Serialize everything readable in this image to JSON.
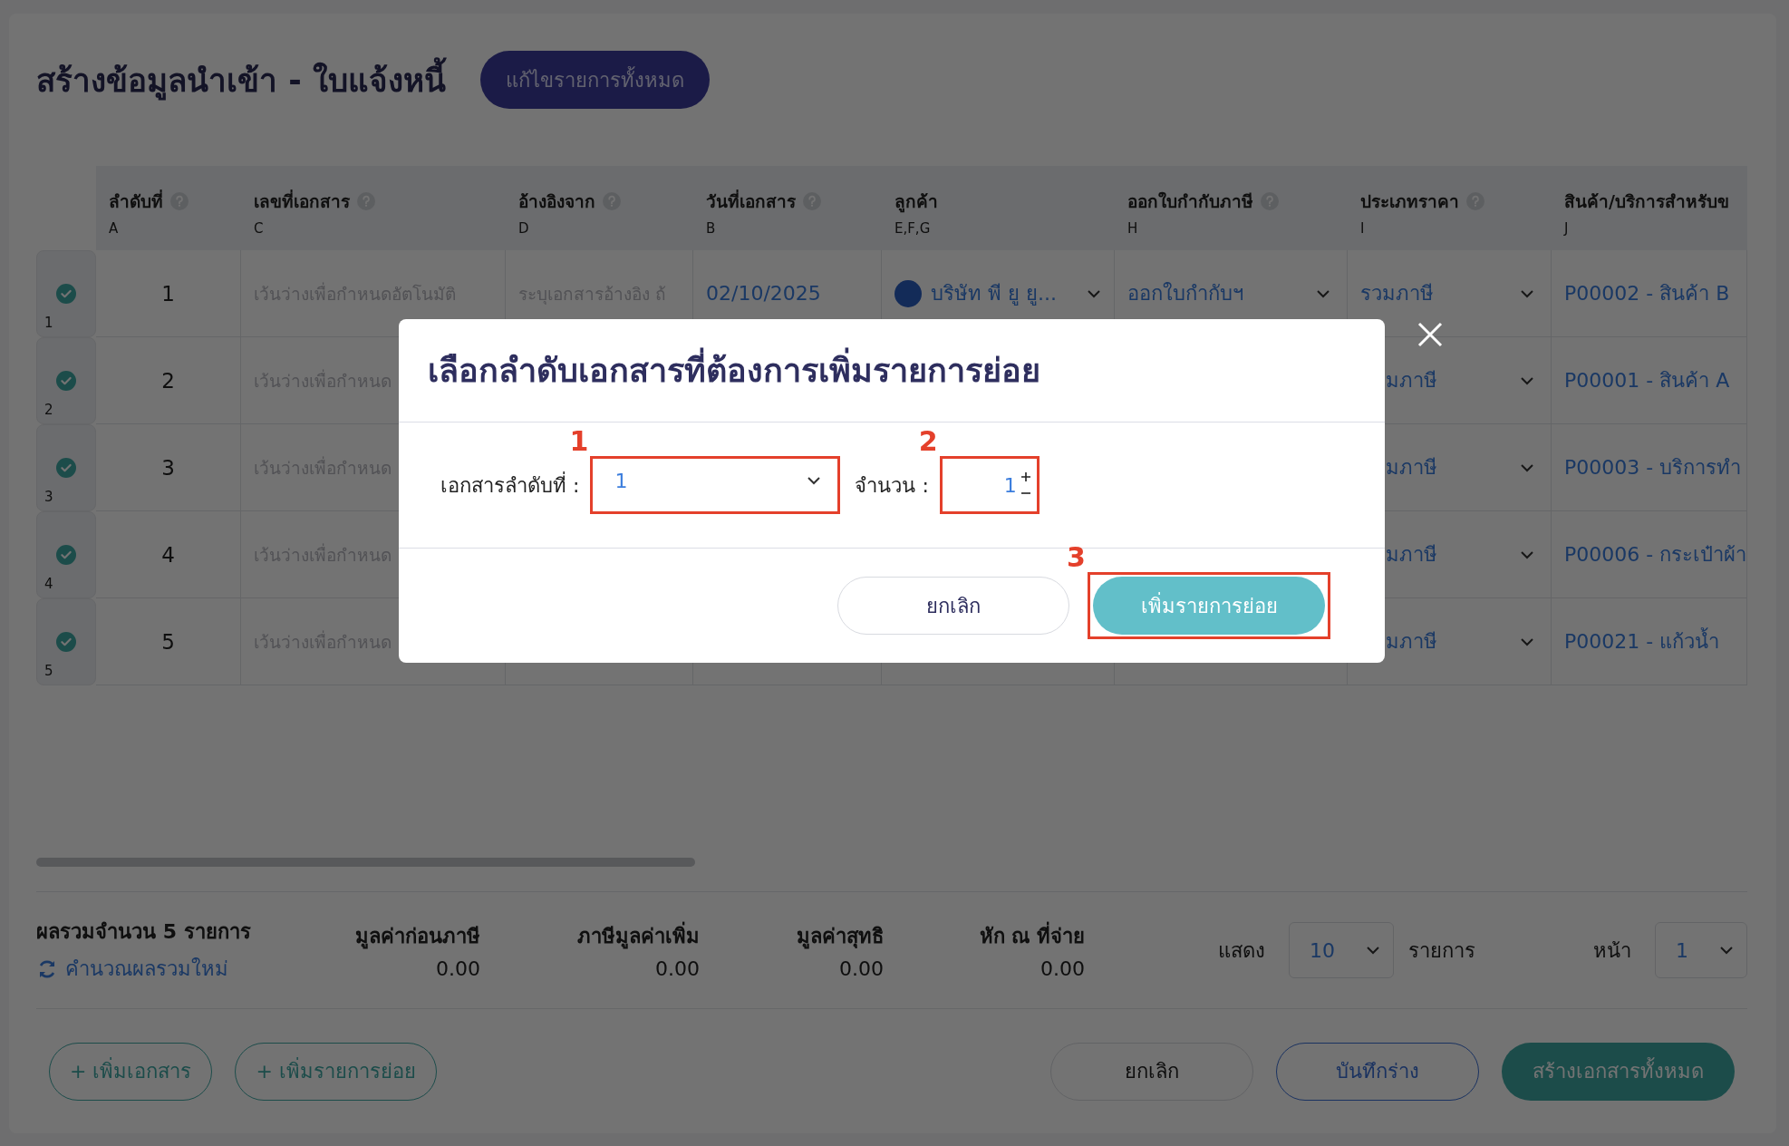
{
  "page": {
    "title": "สร้างข้อมูลนำเข้า - ใบแจ้งหนี้",
    "edit_all_button": "แก้ไขรายการทั้งหมด"
  },
  "table": {
    "columns": [
      {
        "label": "ลำดับที่",
        "letter": "A",
        "help": true
      },
      {
        "label": "เลขที่เอกสาร",
        "letter": "C",
        "help": true
      },
      {
        "label": "อ้างอิงจาก",
        "letter": "D",
        "help": true
      },
      {
        "label": "วันที่เอกสาร",
        "letter": "B",
        "help": true
      },
      {
        "label": "ลูกค้า",
        "letter": "E,F,G",
        "help": false
      },
      {
        "label": "ออกใบกำกับภาษี",
        "letter": "H",
        "help": true
      },
      {
        "label": "ประเภทราคา",
        "letter": "I",
        "help": true
      },
      {
        "label": "สินค้า/บริการสำหรับข",
        "letter": "J",
        "help": false
      }
    ],
    "rows": [
      {
        "row_label": "1",
        "checked": true,
        "cells": [
          {
            "kind": "number",
            "text": "1"
          },
          {
            "kind": "placeholder",
            "text": "เว้นว่างเพื่อกำหนดอัตโนมัติ"
          },
          {
            "kind": "placeholder",
            "text": "ระบุเอกสารอ้างอิง ถ้"
          },
          {
            "kind": "date",
            "text": "02/10/2025"
          },
          {
            "kind": "customer",
            "text": "บริษัท พี ยู ยู..."
          },
          {
            "kind": "select",
            "text": "ออกใบกำกับฯ"
          },
          {
            "kind": "select",
            "text": "รวมภาษี"
          },
          {
            "kind": "link",
            "text": "P00002 - สินค้า B"
          }
        ]
      },
      {
        "row_label": "2",
        "checked": true,
        "cells": [
          {
            "kind": "number",
            "text": "2"
          },
          {
            "kind": "placeholder",
            "text": "เว้นว่างเพื่อกำหนด"
          },
          {
            "kind": "hidden"
          },
          {
            "kind": "hidden"
          },
          {
            "kind": "hidden"
          },
          {
            "kind": "hidden"
          },
          {
            "kind": "select-covered",
            "text": "มภาษี"
          },
          {
            "kind": "link",
            "text": "P00001 - สินค้า A"
          }
        ]
      },
      {
        "row_label": "3",
        "checked": true,
        "cells": [
          {
            "kind": "number",
            "text": "3"
          },
          {
            "kind": "placeholder",
            "text": "เว้นว่างเพื่อกำหนด"
          },
          {
            "kind": "hidden"
          },
          {
            "kind": "hidden"
          },
          {
            "kind": "hidden"
          },
          {
            "kind": "hidden"
          },
          {
            "kind": "select-covered",
            "text": "มภาษี"
          },
          {
            "kind": "link",
            "text": "P00003 - บริการทำ"
          }
        ]
      },
      {
        "row_label": "4",
        "checked": true,
        "cells": [
          {
            "kind": "number",
            "text": "4"
          },
          {
            "kind": "placeholder",
            "text": "เว้นว่างเพื่อกำหนด"
          },
          {
            "kind": "hidden"
          },
          {
            "kind": "hidden"
          },
          {
            "kind": "hidden"
          },
          {
            "kind": "hidden"
          },
          {
            "kind": "select-covered",
            "text": "มภาษี"
          },
          {
            "kind": "link",
            "text": "P00006 - กระเป๋าผ้า"
          }
        ]
      },
      {
        "row_label": "5",
        "checked": true,
        "cells": [
          {
            "kind": "number",
            "text": "5"
          },
          {
            "kind": "placeholder",
            "text": "เว้นว่างเพื่อกำหนด"
          },
          {
            "kind": "hidden"
          },
          {
            "kind": "hidden"
          },
          {
            "kind": "hidden"
          },
          {
            "kind": "hidden"
          },
          {
            "kind": "select-covered",
            "text": "มภาษี"
          },
          {
            "kind": "link",
            "text": "P00021 - แก้วน้ำ"
          }
        ]
      }
    ]
  },
  "summary": {
    "count_label": "ผลรวมจำนวน 5 รายการ",
    "recalculate_link": "คำนวณผลรวมใหม่",
    "totals": [
      {
        "label": "มูลค่าก่อนภาษี",
        "value": "0.00"
      },
      {
        "label": "ภาษีมูลค่าเพิ่ม",
        "value": "0.00"
      },
      {
        "label": "มูลค่าสุทธิ",
        "value": "0.00"
      },
      {
        "label": "หัก ณ ที่จ่าย",
        "value": "0.00"
      }
    ],
    "show_label": "แสดง",
    "page_size": "10",
    "page_size_unit": "รายการ",
    "page_label": "หน้า",
    "page": "1"
  },
  "actions": {
    "left": [
      "+ เพิ่มเอกสาร",
      "+ เพิ่มรายการย่อย"
    ],
    "right": [
      {
        "label": "ยกเลิก",
        "kind": "plain"
      },
      {
        "label": "บันทึกร่าง",
        "kind": "outline"
      },
      {
        "label": "สร้างเอกสารทั้งหมด",
        "kind": "primary"
      }
    ]
  },
  "modal": {
    "title": "เลือกลำดับเอกสารที่ต้องการเพิ่มรายการย่อย",
    "fields": [
      {
        "label": "เอกสารลำดับที่ :",
        "value": "1",
        "kind": "select",
        "marker": "1"
      },
      {
        "label": "จำนวน :",
        "value": "1",
        "kind": "stepper",
        "marker": "2"
      }
    ],
    "buttons": [
      {
        "label": "ยกเลิก",
        "kind": "secondary"
      },
      {
        "label": "เพิ่มรายการย่อย",
        "kind": "primary",
        "marker": "3"
      }
    ]
  }
}
